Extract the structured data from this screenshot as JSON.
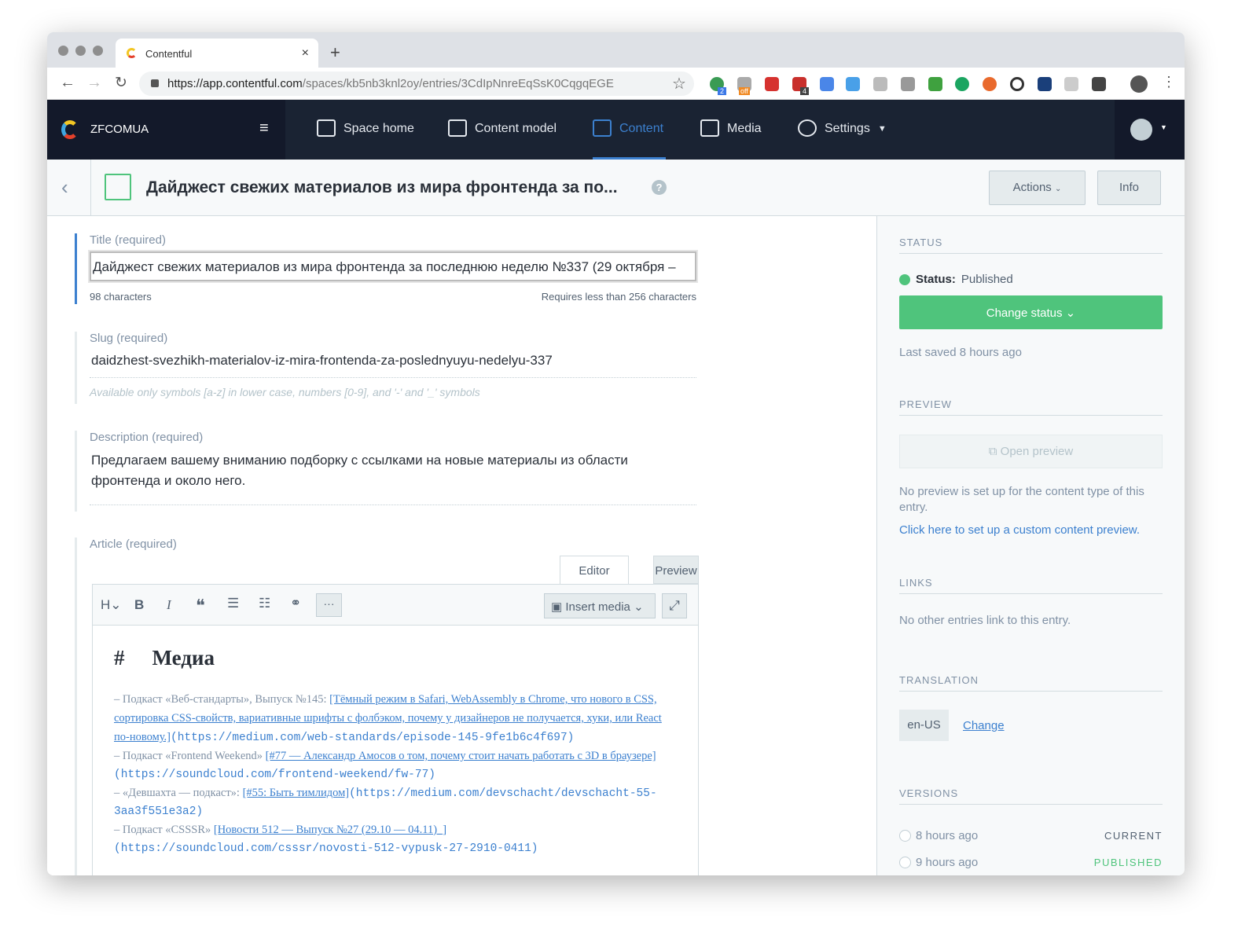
{
  "browser": {
    "tab_title": "Contentful",
    "url_host": "https://app.contentful.com",
    "url_path": "/spaces/kb5nb3knl2oy/entries/3CdIpNnreEqSsK0CqgqEGE",
    "ext_badges": [
      "2",
      "off",
      "4"
    ]
  },
  "nav": {
    "space": "ZFCOMUA",
    "items": [
      "Space home",
      "Content model",
      "Content",
      "Media",
      "Settings"
    ],
    "active": "Content"
  },
  "entry": {
    "title": "Дайджест свежих материалов из мира фронтенда за по...",
    "actions": "Actions",
    "info": "Info"
  },
  "fields": {
    "title": {
      "label": "Title (required)",
      "value": "Дайджест свежих материалов из мира фронтенда за последнюю неделю №337 (29 октября –",
      "count": "98 characters",
      "limit": "Requires less than 256 characters"
    },
    "slug": {
      "label": "Slug (required)",
      "value": "daidzhest-svezhikh-materialov-iz-mira-frontenda-za-poslednyuyu-nedelyu-337",
      "hint": "Available only symbols [a-z] in lower case, numbers [0-9], and '-' and '_' symbols"
    },
    "description": {
      "label": "Description (required)",
      "value": "Предлагаем вашему вниманию подборку с ссылками на новые материалы из области фронтенда и около него."
    },
    "article": {
      "label": "Article (required)",
      "tabs": [
        "Editor",
        "Preview"
      ],
      "insert_media": "Insert media",
      "heading": "Медиа",
      "lines": [
        {
          "pre": "– Подкаст «Веб-стандарты», Выпуск №145: ",
          "link": "[Тёмный режим в Safari, WebAssembly в Chrome, что нового в CSS, сортировка CSS-свойств, вариативные шрифты с фолбэком, почему у дизайнеров не получается, хуки, или React по-новому.]",
          "url": "(https://medium.com/web-standards/episode-145-9fe1b6c4f697)"
        },
        {
          "pre": "– Подкаст «Frontend Weekend» ",
          "link": "[#77 — Александр Амосов о том, почему стоит начать работать с 3D в браузере]",
          "url": "(https://soundcloud.com/frontend-weekend/fw-77)"
        },
        {
          "pre": "– «Девшахта — подкаст»: ",
          "link": "[#55: Быть тимлидом]",
          "url": "(https://medium.com/devschacht/devschacht-55-3aa3f551e3a2)"
        },
        {
          "pre": "– Подкаст «CSSSR» ",
          "link": "[Новости 512 — Выпуск №27 (29.10 — 04.11)_]",
          "url": "(https://soundcloud.com/csssr/novosti-512-vypusk-27-2910-0411)"
        }
      ]
    }
  },
  "sidebar": {
    "status": {
      "heading": "STATUS",
      "label": "Status:",
      "value": "Published",
      "button": "Change status",
      "saved": "Last saved 8 hours ago",
      "color": "#4fc47c"
    },
    "preview": {
      "heading": "PREVIEW",
      "button": "Open preview",
      "note": "No preview is set up for the content type of this entry.",
      "link": "Click here to set up a custom content preview."
    },
    "links": {
      "heading": "LINKS",
      "note": "No other entries link to this entry."
    },
    "translation": {
      "heading": "TRANSLATION",
      "locale": "en-US",
      "change": "Change"
    },
    "versions": {
      "heading": "VERSIONS",
      "items": [
        {
          "time": "8 hours ago",
          "tag": "CURRENT"
        },
        {
          "time": "9 hours ago",
          "tag": "PUBLISHED"
        }
      ]
    }
  }
}
